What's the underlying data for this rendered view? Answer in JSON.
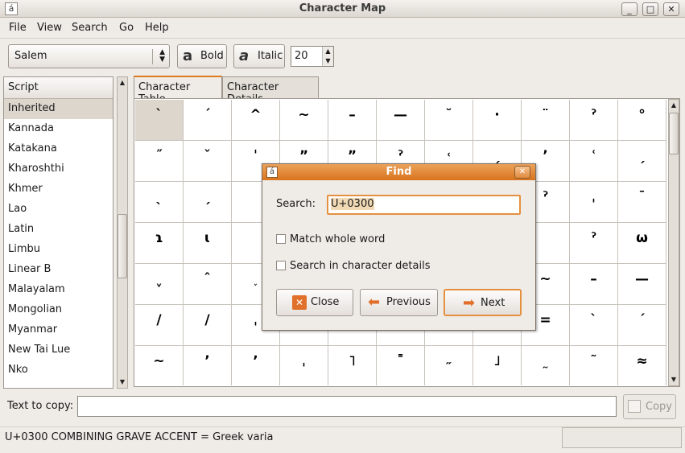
{
  "window": {
    "title": "Character Map",
    "app_icon": "á",
    "minimize": "_",
    "maximize": "□",
    "close": "✕"
  },
  "menu": {
    "items": [
      "File",
      "View",
      "Search",
      "Go",
      "Help"
    ]
  },
  "toolbar": {
    "font": "Salem",
    "bold_label": "Bold",
    "italic_label": "Italic",
    "size": "20",
    "combo_arrows": "▲▼"
  },
  "script_list": {
    "header": "Script",
    "items": [
      "Inherited",
      "Kannada",
      "Katakana",
      "Kharoshthi",
      "Khmer",
      "Lao",
      "Latin",
      "Limbu",
      "Linear B",
      "Malayalam",
      "Mongolian",
      "Myanmar",
      "New Tai Lue",
      "Nko"
    ],
    "selected_index": 0
  },
  "tabs": [
    "Character Table",
    "Character Details"
  ],
  "grid": {
    "rows": [
      [
        "`",
        "´",
        "^",
        "~",
        "–",
        "—",
        "˘",
        "·",
        "¨",
        "ˀ",
        "°"
      ],
      [
        "˝",
        "ˇ",
        "ˈ",
        "ˮ",
        "ˮ",
        "ˀ",
        "˓",
        "ˏ",
        "’",
        "ʿ",
        "ˏ"
      ],
      [
        "ˎ",
        "ˏ",
        "",
        "",
        "",
        "",
        "",
        "",
        "ˀ",
        "ˌ",
        "ˉ"
      ],
      [
        "ɿ",
        "ɩ",
        "",
        "",
        "",
        "",
        "",
        "",
        "",
        "ˀ",
        "ω"
      ],
      [
        "ˬ",
        "ˆ",
        "˯",
        "",
        "",
        "",
        "",
        "",
        "~",
        "–",
        "—"
      ],
      [
        "/",
        "/",
        "ˌ",
        "",
        "",
        "",
        "",
        "",
        "=",
        "ˋ",
        "ˊ"
      ],
      [
        "~",
        "’",
        "ʼ",
        "ˌ",
        "˥",
        "˭",
        "˶",
        "˩",
        "˷",
        "˜",
        "≈"
      ]
    ],
    "selected": [
      0,
      0
    ]
  },
  "bottom": {
    "copy_label": "Text to copy:",
    "copy_value": "",
    "copy_button": "Copy",
    "status": "U+0300 COMBINING GRAVE ACCENT   = Greek varia"
  },
  "find_dialog": {
    "title": "Find",
    "search_label": "Search:",
    "search_value": "U+0300",
    "match_whole_word": {
      "label": "Match whole word",
      "checked": false
    },
    "search_details": {
      "label": "Search in character details",
      "checked": false
    },
    "close_label": "Close",
    "previous_label": "Previous",
    "next_label": "Next",
    "accent": "#e5913f"
  }
}
